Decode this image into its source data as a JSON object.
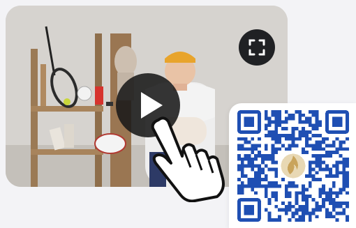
{
  "video": {
    "play_icon": "play-icon",
    "fullscreen_icon": "fullscreen-icon",
    "play_state": "paused"
  },
  "qr": {
    "icon": "qr-code",
    "center_emblem": "flame-emblem-icon",
    "color": "#1f4fb3"
  },
  "cursor": {
    "icon": "hand-pointer-icon"
  },
  "colors": {
    "qr_blue": "#1f4fb3",
    "emblem_gold": "#c9a45c",
    "button_dark": "#202124",
    "beanie": "#e8a42c"
  }
}
